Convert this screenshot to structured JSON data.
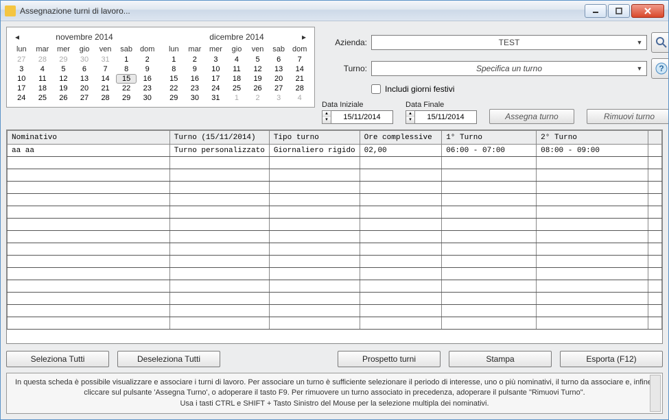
{
  "window": {
    "title": "Assegnazione turni di lavoro..."
  },
  "calendar1": {
    "title": "novembre 2014",
    "days_header": [
      "lun",
      "mar",
      "mer",
      "gio",
      "ven",
      "sab",
      "dom"
    ],
    "weeks": [
      [
        {
          "d": "27",
          "m": true
        },
        {
          "d": "28",
          "m": true
        },
        {
          "d": "29",
          "m": true
        },
        {
          "d": "30",
          "m": true
        },
        {
          "d": "31",
          "m": true
        },
        {
          "d": "1"
        },
        {
          "d": "2"
        }
      ],
      [
        {
          "d": "3"
        },
        {
          "d": "4"
        },
        {
          "d": "5"
        },
        {
          "d": "6"
        },
        {
          "d": "7"
        },
        {
          "d": "8"
        },
        {
          "d": "9"
        }
      ],
      [
        {
          "d": "10"
        },
        {
          "d": "11"
        },
        {
          "d": "12"
        },
        {
          "d": "13"
        },
        {
          "d": "14"
        },
        {
          "d": "15",
          "sel": true
        },
        {
          "d": "16"
        }
      ],
      [
        {
          "d": "17"
        },
        {
          "d": "18"
        },
        {
          "d": "19"
        },
        {
          "d": "20"
        },
        {
          "d": "21"
        },
        {
          "d": "22"
        },
        {
          "d": "23"
        }
      ],
      [
        {
          "d": "24"
        },
        {
          "d": "25"
        },
        {
          "d": "26"
        },
        {
          "d": "27"
        },
        {
          "d": "28"
        },
        {
          "d": "29"
        },
        {
          "d": "30"
        }
      ]
    ]
  },
  "calendar2": {
    "title": "dicembre 2014",
    "days_header": [
      "lun",
      "mar",
      "mer",
      "gio",
      "ven",
      "sab",
      "dom"
    ],
    "weeks": [
      [
        {
          "d": "1"
        },
        {
          "d": "2"
        },
        {
          "d": "3"
        },
        {
          "d": "4"
        },
        {
          "d": "5"
        },
        {
          "d": "6"
        },
        {
          "d": "7"
        }
      ],
      [
        {
          "d": "8"
        },
        {
          "d": "9"
        },
        {
          "d": "10"
        },
        {
          "d": "11"
        },
        {
          "d": "12"
        },
        {
          "d": "13"
        },
        {
          "d": "14"
        }
      ],
      [
        {
          "d": "15"
        },
        {
          "d": "16"
        },
        {
          "d": "17"
        },
        {
          "d": "18"
        },
        {
          "d": "19"
        },
        {
          "d": "20"
        },
        {
          "d": "21"
        }
      ],
      [
        {
          "d": "22"
        },
        {
          "d": "23"
        },
        {
          "d": "24"
        },
        {
          "d": "25"
        },
        {
          "d": "26"
        },
        {
          "d": "27"
        },
        {
          "d": "28"
        }
      ],
      [
        {
          "d": "29"
        },
        {
          "d": "30"
        },
        {
          "d": "31"
        },
        {
          "d": "1",
          "m": true
        },
        {
          "d": "2",
          "m": true
        },
        {
          "d": "3",
          "m": true
        },
        {
          "d": "4",
          "m": true
        }
      ]
    ]
  },
  "controls": {
    "azienda_label": "Azienda:",
    "azienda_value": "TEST",
    "turno_label": "Turno:",
    "turno_value": "Specifica un turno",
    "includi_festivi_label": "Includi giorni festivi",
    "data_iniziale_label": "Data Iniziale",
    "data_iniziale_value": "15/11/2014",
    "data_finale_label": "Data Finale",
    "data_finale_value": "15/11/2014",
    "assegna_label": "Assegna turno",
    "rimuovi_label": "Rimuovi turno"
  },
  "grid": {
    "columns": [
      "Nominativo",
      "Turno (15/11/2014)",
      "Tipo turno",
      "Ore complessive",
      "1° Turno",
      "2° Turno"
    ],
    "rows": [
      {
        "nominativo": "aa aa",
        "turno": "Turno personalizzato",
        "tipo": "Giornaliero rigido",
        "ore": "02,00",
        "t1": "06:00 - 07:00",
        "t2": "08:00 - 09:00"
      }
    ],
    "empty_rows": 14
  },
  "buttons": {
    "seleziona_tutti": "Seleziona Tutti",
    "deseleziona_tutti": "Deseleziona Tutti",
    "prospetto": "Prospetto turni",
    "stampa": "Stampa",
    "esporta": "Esporta (F12)"
  },
  "help": {
    "line1": "In questa scheda è possibile visualizzare e associare i turni di lavoro. Per associare un turno è sufficiente selezionare il periodo di interesse, uno o più nominativi, il turno da associare e, infine,",
    "line2": "cliccare sul pulsante 'Assegna Turno', o adoperare il tasto F9. Per rimuovere un turno associato in precedenza, adoperare il pulsante \"Rimuovi Turno\".",
    "line3": "Usa i tasti CTRL e  SHIFT + Tasto Sinistro del Mouse per la selezione multipla dei nominativi."
  }
}
